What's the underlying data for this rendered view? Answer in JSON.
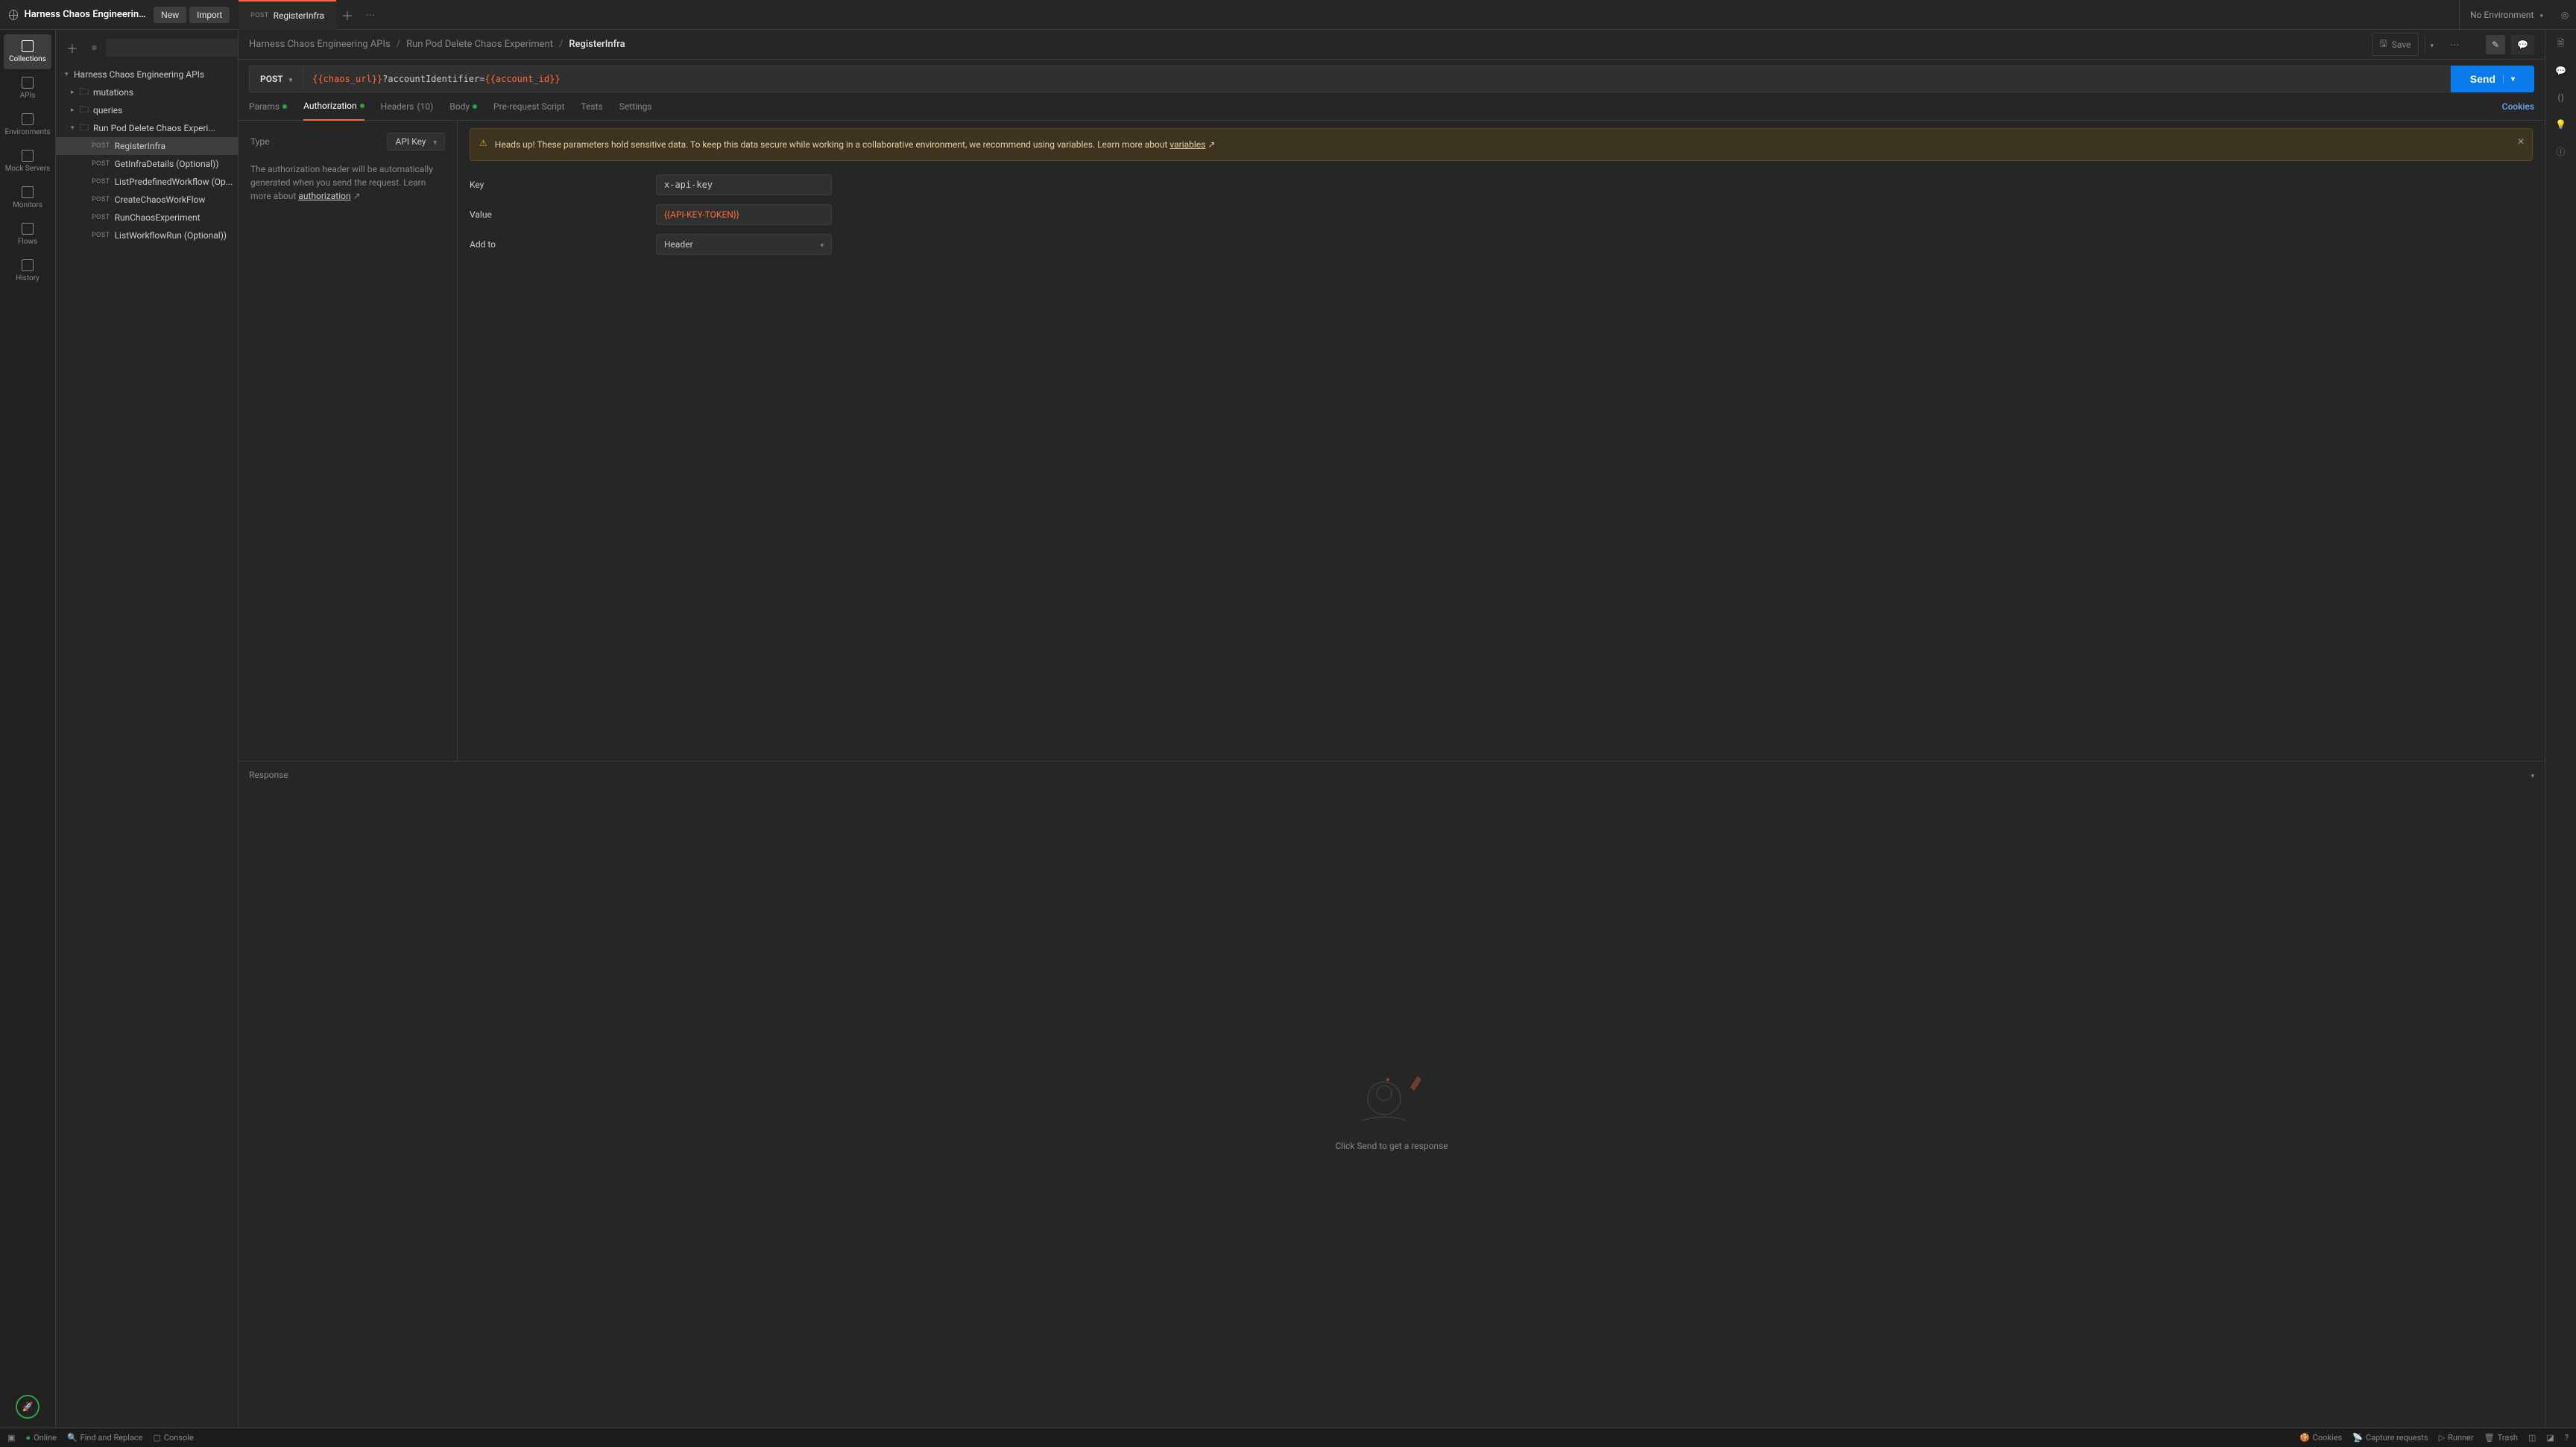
{
  "header": {
    "workspace_title": "Harness Chaos Engineering - P...",
    "new_btn": "New",
    "import_btn": "Import",
    "environment": "No Environment"
  },
  "tab": {
    "method": "POST",
    "name": "RegisterInfra"
  },
  "left_rail": [
    {
      "label": "Collections",
      "active": true
    },
    {
      "label": "APIs"
    },
    {
      "label": "Environments"
    },
    {
      "label": "Mock Servers"
    },
    {
      "label": "Monitors"
    },
    {
      "label": "Flows"
    },
    {
      "label": "History"
    }
  ],
  "tree": {
    "root": "Harness Chaos Engineering APIs",
    "folders": [
      {
        "label": "mutations"
      },
      {
        "label": "queries"
      }
    ],
    "open_folder": "Run Pod Delete Chaos Experi...",
    "items": [
      {
        "method": "POST",
        "label": "RegisterInfra",
        "selected": true
      },
      {
        "method": "POST",
        "label": "GetInfraDetails (Optional))"
      },
      {
        "method": "POST",
        "label": "ListPredefinedWorkflow (Op..."
      },
      {
        "method": "POST",
        "label": "CreateChaosWorkFlow"
      },
      {
        "method": "POST",
        "label": "RunChaosExperiment"
      },
      {
        "method": "POST",
        "label": "ListWorkflowRun (Optional))"
      }
    ]
  },
  "crumbs": {
    "a": "Harness Chaos Engineering APIs",
    "b": "Run Pod Delete Chaos Experiment",
    "c": "RegisterInfra",
    "save": "Save"
  },
  "request": {
    "method": "POST",
    "url_var1": "{{chaos_url}}",
    "url_plain": "?accountIdentifier=",
    "url_var2": "{{account_id}}",
    "send": "Send"
  },
  "subtabs": {
    "params": "Params",
    "auth": "Authorization",
    "headers": "Headers",
    "headers_count": "(10)",
    "body": "Body",
    "pre": "Pre-request Script",
    "tests": "Tests",
    "settings": "Settings",
    "cookies": "Cookies"
  },
  "auth": {
    "type_label": "Type",
    "type_value": "API Key",
    "desc1": "The authorization header will be automatically generated when you send the request. Learn more about ",
    "desc_link": "authorization",
    "banner": "Heads up! These parameters hold sensitive data. To keep this data secure while working in a collaborative environment, we recommend using variables. Learn more about ",
    "banner_link": "variables",
    "key_label": "Key",
    "key_value": "x-api-key",
    "value_label": "Value",
    "value_value": "{{API-KEY-TOKEN}}",
    "addto_label": "Add to",
    "addto_value": "Header"
  },
  "response": {
    "title": "Response",
    "empty": "Click Send to get a response"
  },
  "footer": {
    "online": "Online",
    "find": "Find and Replace",
    "console": "Console",
    "cookies": "Cookies",
    "capture": "Capture requests",
    "runner": "Runner",
    "trash": "Trash"
  }
}
